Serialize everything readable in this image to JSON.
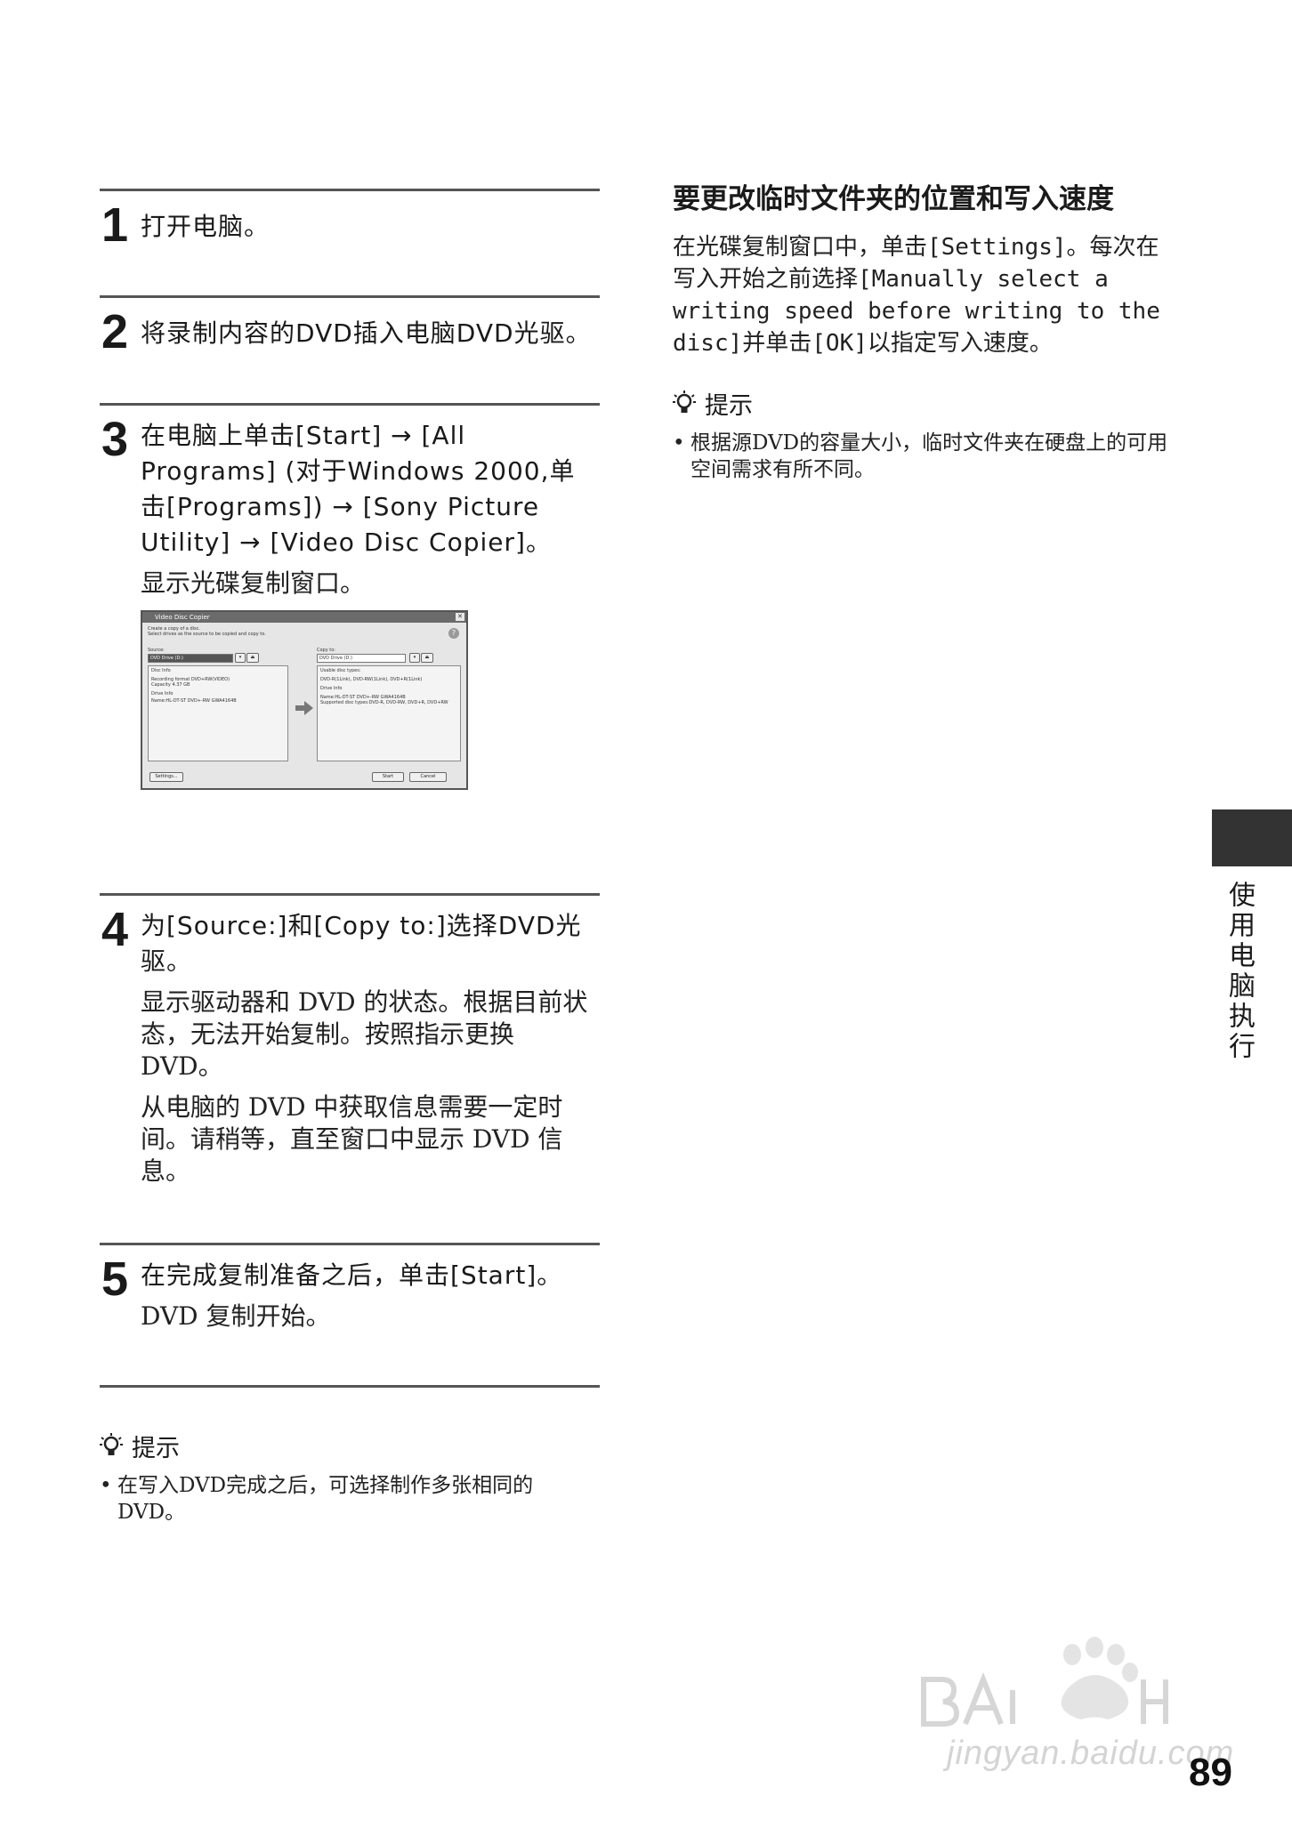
{
  "steps": [
    {
      "num": "1",
      "title": "打开电脑。"
    },
    {
      "num": "2",
      "title": "将录制内容的DVD插入电脑DVD光驱。"
    },
    {
      "num": "3",
      "title": "在电脑上单击[Start] → [All Programs] (对于Windows 2000,单击[Programs]) → [Sony Picture Utility] → [Video Disc Copier]。",
      "body": [
        "显示光碟复制窗口。"
      ]
    },
    {
      "num": "4",
      "title": "为[Source:]和[Copy to:]选择DVD光驱。",
      "body": [
        "显示驱动器和 DVD 的状态。根据目前状态，无法开始复制。按照指示更换 DVD。",
        "从电脑的 DVD 中获取信息需要一定时间。请稍等，直至窗口中显示 DVD 信息。"
      ]
    },
    {
      "num": "5",
      "title": "在完成复制准备之后，单击[Start]。",
      "body": [
        "DVD 复制开始。"
      ]
    }
  ],
  "screenshot": {
    "window_title": "Video Disc Copier",
    "intro_line1": "Create a copy of a disc.",
    "intro_line2": "Select drives as the source to be copied and copy to.",
    "source_label": "Source:",
    "source_value": "DVD Drive (D:)",
    "copy_to_label": "Copy to:",
    "copy_to_value": "DVD Drive (D:)",
    "disc_info_label": "Disc Info",
    "recording_format": "Recording format DVD+RW(VIDEO)",
    "capacity": "Capacity 4.37 GB",
    "drive_info_label": "Drive Info",
    "source_drive_name": "Name:HL-DT-ST DVD+-RW GWA4164B",
    "usable_disc_types_label": "Usable disc types:",
    "usable_disc_types": "DVD-R(1Link), DVD-RW(1Link), DVD+R(1Link)",
    "dest_drive_info_label": "Drive Info",
    "dest_drive_name": "Name:HL-DT-ST DVD+-RW GWA4164B",
    "supported_types": "Supported disc types:DVD-R, DVD-RW, DVD+R, DVD+RW",
    "settings_button": "Settings...",
    "start_button": "Start",
    "cancel_button": "Cancel"
  },
  "right_section": {
    "title": "要更改临时文件夹的位置和写入速度",
    "body": "在光碟复制窗口中，单击[Settings]。每次在写入开始之前选择[Manually select a writing speed before writing to the disc]并单击[OK]以指定写入速度。"
  },
  "hints_right": {
    "heading": "提示",
    "items": [
      "根据源DVD的容量大小，临时文件夹在硬盘上的可用空间需求有所不同。"
    ]
  },
  "hints_left": {
    "heading": "提示",
    "items": [
      "在写入DVD完成之后，可选择制作多张相同的DVD。"
    ]
  },
  "side_label": "使用电脑执行",
  "page_number": "89",
  "watermark": {
    "text": "jingyan.baidu.com"
  }
}
